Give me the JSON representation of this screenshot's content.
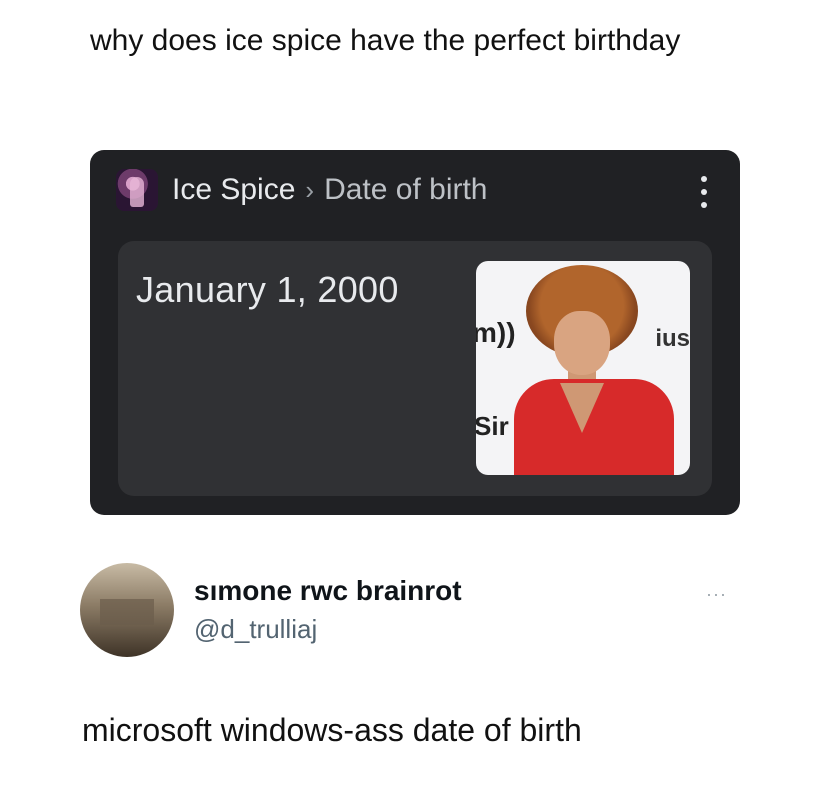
{
  "post": {
    "text": "why does ice spice have the perfect birthday"
  },
  "knowledge_card": {
    "subject": "Ice Spice",
    "separator": "›",
    "attribute": "Date of birth",
    "value": "January 1, 2000",
    "photo_logo_left": "m))",
    "photo_logo_left_2": "Sir",
    "photo_logo_right": "ius"
  },
  "reply": {
    "display_name": "sımone rwc brainrot",
    "handle": "@d_trulliaj",
    "more": "···",
    "text": "microsoft windows-ass date of birth"
  }
}
